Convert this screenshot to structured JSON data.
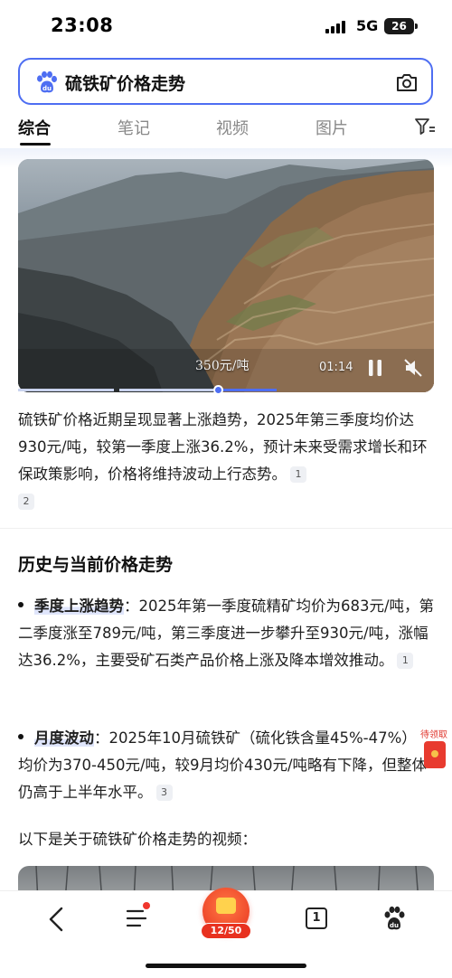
{
  "status": {
    "time": "23:08",
    "network": "5G",
    "battery": "26"
  },
  "search": {
    "query": "硫铁矿价格走势"
  },
  "tabs": [
    {
      "label": "综合",
      "active": true
    },
    {
      "label": "笔记",
      "active": false
    },
    {
      "label": "视频",
      "active": false
    },
    {
      "label": "图片",
      "active": false
    }
  ],
  "video": {
    "caption": "350元/吨",
    "duration": "01:14"
  },
  "answer": {
    "summary": "硫铁矿价格近期呈现显著上涨趋势，2025年第三季度均价达930元/吨，较第一季度上涨36.2%，预计未来受需求增长和环保政策影响，价格将维持波动上行态势。",
    "summary_cites": [
      "1",
      "2"
    ],
    "section_title": "历史与当前价格走势",
    "bullets": [
      {
        "key": "季度上涨趋势",
        "text": "：2025年第一季度硫精矿均价为683元/吨，第二季度涨至789元/吨，第三季度进一步攀升至930元/吨，涨幅达36.2%，主要受矿石类产品价格上涨及降本增效推动。",
        "cite": "1"
      },
      {
        "key": "月度波动",
        "text": "：2025年10月硫铁矿（硫化铁含量45%-47%）均价为370-450元/吨，较9月均价430元/吨略有下降，但整体仍高于上半年水平。",
        "cite": "3"
      }
    ],
    "video_intro": "以下是关于硫铁矿价格走势的视频："
  },
  "side": {
    "redpacket_label": "待领取"
  },
  "bottom_nav": {
    "reward_count": "12/50",
    "pages": "1"
  },
  "colors": {
    "accent": "#4e6ef2",
    "highlight": "#dfe5fb",
    "reward": "#e8311f"
  }
}
